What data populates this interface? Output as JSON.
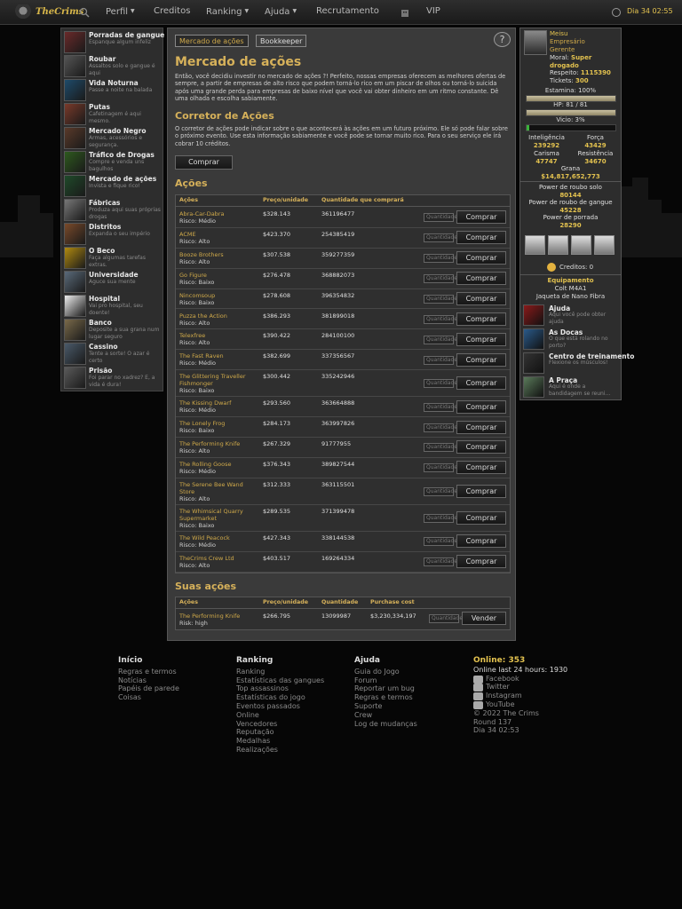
{
  "topnav": {
    "logo": "TheCrims",
    "items": [
      {
        "label": "Perfil",
        "caret": true
      },
      {
        "label": "Creditos",
        "caret": false
      },
      {
        "label": "Ranking",
        "caret": true
      },
      {
        "label": "Ajuda",
        "caret": true
      },
      {
        "label": "Recrutamento",
        "caret": false
      },
      {
        "label": "VIP",
        "caret": false
      }
    ],
    "day_time": "Dia 34 02:55"
  },
  "sidebar": {
    "items": [
      {
        "title": "Porradas de gangue",
        "desc": "Espanque algum infeliz",
        "icon": "knife-icon"
      },
      {
        "title": "Roubar",
        "desc": "Assaltos solo e gangue é aqui",
        "icon": "robbery-icon"
      },
      {
        "title": "Vida Noturna",
        "desc": "Passe a noite na balada",
        "icon": "nightlife-icon"
      },
      {
        "title": "Putas",
        "desc": "Cafetinagem é aqui mesmo.",
        "icon": "hookers-icon"
      },
      {
        "title": "Mercado Negro",
        "desc": "Armas, acessórios e segurança.",
        "icon": "gun-icon"
      },
      {
        "title": "Tráfico de Drogas",
        "desc": "Compre e venda uns bagulhos",
        "icon": "weed-icon"
      },
      {
        "title": "Mercado de ações",
        "desc": "Invista e fique rico!",
        "icon": "stocks-icon"
      },
      {
        "title": "Fábricas",
        "desc": "Produza aqui suas próprias drogas",
        "icon": "factory-icon"
      },
      {
        "title": "Distritos",
        "desc": "Expanda o seu império",
        "icon": "district-icon"
      },
      {
        "title": "O Beco",
        "desc": "Faça algumas tarefas extras.",
        "icon": "road-sign-icon"
      },
      {
        "title": "Universidade",
        "desc": "Aguce sua mente",
        "icon": "university-icon"
      },
      {
        "title": "Hospital",
        "desc": "Vai pro hospital, seu doente!",
        "icon": "hospital-cross-icon"
      },
      {
        "title": "Banco",
        "desc": "Deposite a sua grana num lugar seguro",
        "icon": "money-bag-icon"
      },
      {
        "title": "Cassino",
        "desc": "Tente a sorte! O azar é certo",
        "icon": "casino-icon"
      },
      {
        "title": "Prisão",
        "desc": "Foi parar no xadrez? É, a vida é dura!",
        "icon": "prison-icon"
      }
    ]
  },
  "main": {
    "tabs": [
      "Mercado de ações",
      "Bookkeeper"
    ],
    "help": "?",
    "title": "Mercado de ações",
    "intro": "Então, você decidiu investir no mercado de ações ?! Perfeito, nossas empresas oferecem as melhores ofertas de sempre, a partir de empresas de alto risco que podem torná-lo rico em um piscar de olhos ou torná-lo suicida após uma grande perda para empresas de baixo nível que você vai obter dinheiro em um ritmo constante. Dê uma olhada e escolha sabiamente.",
    "broker_title": "Corretor de Ações",
    "broker_text": "O corretor de ações pode indicar sobre o que acontecerá às ações em um futuro próximo. Ele só pode falar sobre o próximo evento. Use esta informação sabiamente e você pode se tornar muito rico. Para o seu serviço ele irá cobrar 10 créditos.",
    "buy_label": "Comprar",
    "stocks_title": "Ações",
    "stocks_headers": [
      "Ações",
      "Preço/unidade",
      "Quantidade que comprará"
    ],
    "qty_placeholder": "Quantidade",
    "row_button": "Comprar",
    "stocks": [
      {
        "name": "Abra-Car-Dabra",
        "risk": "Risco: Médio",
        "price": "$328.143",
        "qty": "361196477"
      },
      {
        "name": "ACME",
        "risk": "Risco: Alto",
        "price": "$423.370",
        "qty": "254385419"
      },
      {
        "name": "Booze Brothers",
        "risk": "Risco: Alto",
        "price": "$307.538",
        "qty": "359277359"
      },
      {
        "name": "Go Figure",
        "risk": "Risco: Baixo",
        "price": "$276.478",
        "qty": "368882073"
      },
      {
        "name": "Nincomsoup",
        "risk": "Risco: Baixo",
        "price": "$278.608",
        "qty": "396354832"
      },
      {
        "name": "Puzza the Action",
        "risk": "Risco: Alto",
        "price": "$386.293",
        "qty": "381899018"
      },
      {
        "name": "Telexfree",
        "risk": "Risco: Alto",
        "price": "$390.422",
        "qty": "284100100"
      },
      {
        "name": "The Fast Raven",
        "risk": "Risco: Médio",
        "price": "$382.699",
        "qty": "337356567"
      },
      {
        "name": "The Glittering Traveller Fishmonger",
        "risk": "Risco: Baixo",
        "price": "$300.442",
        "qty": "335242946"
      },
      {
        "name": "The Kissing Dwarf",
        "risk": "Risco: Médio",
        "price": "$293.560",
        "qty": "363664888"
      },
      {
        "name": "The Lonely Frog",
        "risk": "Risco: Baixo",
        "price": "$284.173",
        "qty": "363997826"
      },
      {
        "name": "The Performing Knife",
        "risk": "Risco: Alto",
        "price": "$267.329",
        "qty": "91777955"
      },
      {
        "name": "The Rolling Goose",
        "risk": "Risco: Médio",
        "price": "$376.343",
        "qty": "389827544"
      },
      {
        "name": "The Serene Bee Wand Store",
        "risk": "Risco: Alto",
        "price": "$312.333",
        "qty": "363115501"
      },
      {
        "name": "The Whimsical Quarry Supermarket",
        "risk": "Risco: Baixo",
        "price": "$289.535",
        "qty": "371399478"
      },
      {
        "name": "The Wild Peacock",
        "risk": "Risco: Médio",
        "price": "$427.343",
        "qty": "338144538"
      },
      {
        "name": "TheCrims Crew Ltd",
        "risk": "Risco: Alto",
        "price": "$403.517",
        "qty": "169264334"
      }
    ],
    "mine_title": "Suas ações",
    "mine_headers": [
      "Ações",
      "Preço/unidade",
      "Quantidade",
      "Purchase cost"
    ],
    "mine_button": "Vender",
    "mine": [
      {
        "name": "The Performing Knife",
        "risk": "Risk: high",
        "price": "$266.795",
        "qty": "13099987",
        "cost": "$3,230,334,197"
      }
    ]
  },
  "profile": {
    "name": "Meisu",
    "role": "Empresário",
    "rank": "Gerente",
    "moral_label": "Moral:",
    "moral_value": "Super drogado",
    "respect_label": "Respeito:",
    "respect_value": "1115390",
    "tickets_label": "Tickets:",
    "tickets_value": "300",
    "stamina_label": "Estamina: 100%",
    "stamina_fraction": 1.0,
    "hp_label": "HP: 81 / 81",
    "hp_fraction": 1.0,
    "vicio_label": "Vicio: 3%",
    "vicio_fraction": 0.03,
    "stats": {
      "intel_label": "Inteligência",
      "intel": "239292",
      "forca_label": "Força",
      "forca": "43429",
      "carisma_label": "Carisma",
      "carisma": "47747",
      "resist_label": "Resistência",
      "resist": "34670",
      "grana_label": "Grana",
      "grana": "$14,817,652,773"
    },
    "power": {
      "solo_label": "Power de roubo solo",
      "solo": "80144",
      "gang_label": "Power de roubo de gangue",
      "gang": "45228",
      "porrada_label": "Power de porrada",
      "porrada": "28290"
    },
    "credits": "Creditos: 0",
    "equip_title": "Equipamento",
    "equip_weapon": "Colt M4A1",
    "equip_armor": "Jaqueta de Nano Fibra",
    "locations": [
      {
        "title": "Ajuda",
        "desc": "Aqui você pode obter ajuda",
        "icon": "help-question-icon"
      },
      {
        "title": "As Docas",
        "desc": "O que está rolando no porto?",
        "icon": "docks-icon"
      },
      {
        "title": "Centro de treinamento",
        "desc": "Flexione os músculos!",
        "icon": "training-icon"
      },
      {
        "title": "A Praça",
        "desc": "Aqui é onde a bandidagem se reuni...",
        "icon": "square-icon"
      }
    ]
  },
  "footer": {
    "col1_title": "Início",
    "col1": [
      "Regras e termos",
      "Notícias",
      "Papéis de parede",
      "Coisas"
    ],
    "col2_title": "Ranking",
    "col2": [
      "Ranking",
      "Estatísticas das gangues",
      "Top assassinos",
      "Estatísticas do jogo",
      "Eventos passados",
      "Online",
      "Vencedores",
      "Reputação",
      "Medalhas",
      "Realizações"
    ],
    "col3_title": "Ajuda",
    "col3": [
      "Guia do Jogo",
      "Forum",
      "Reportar um bug",
      "Regras e termos",
      "Suporte",
      "Crew",
      "Log de mudanças"
    ],
    "online": "Online: 353",
    "last24": "Online last 24 hours: 1930",
    "social": [
      "Facebook",
      "Twitter",
      "Instagram",
      "YouTube"
    ],
    "copyright": "© 2022 The Crims",
    "round": "Round 137",
    "day": "Dia 34 02:53"
  },
  "colors": {
    "accent": "#d6b15a",
    "gold": "#e3c24f",
    "panel": "#3a3a3a"
  }
}
